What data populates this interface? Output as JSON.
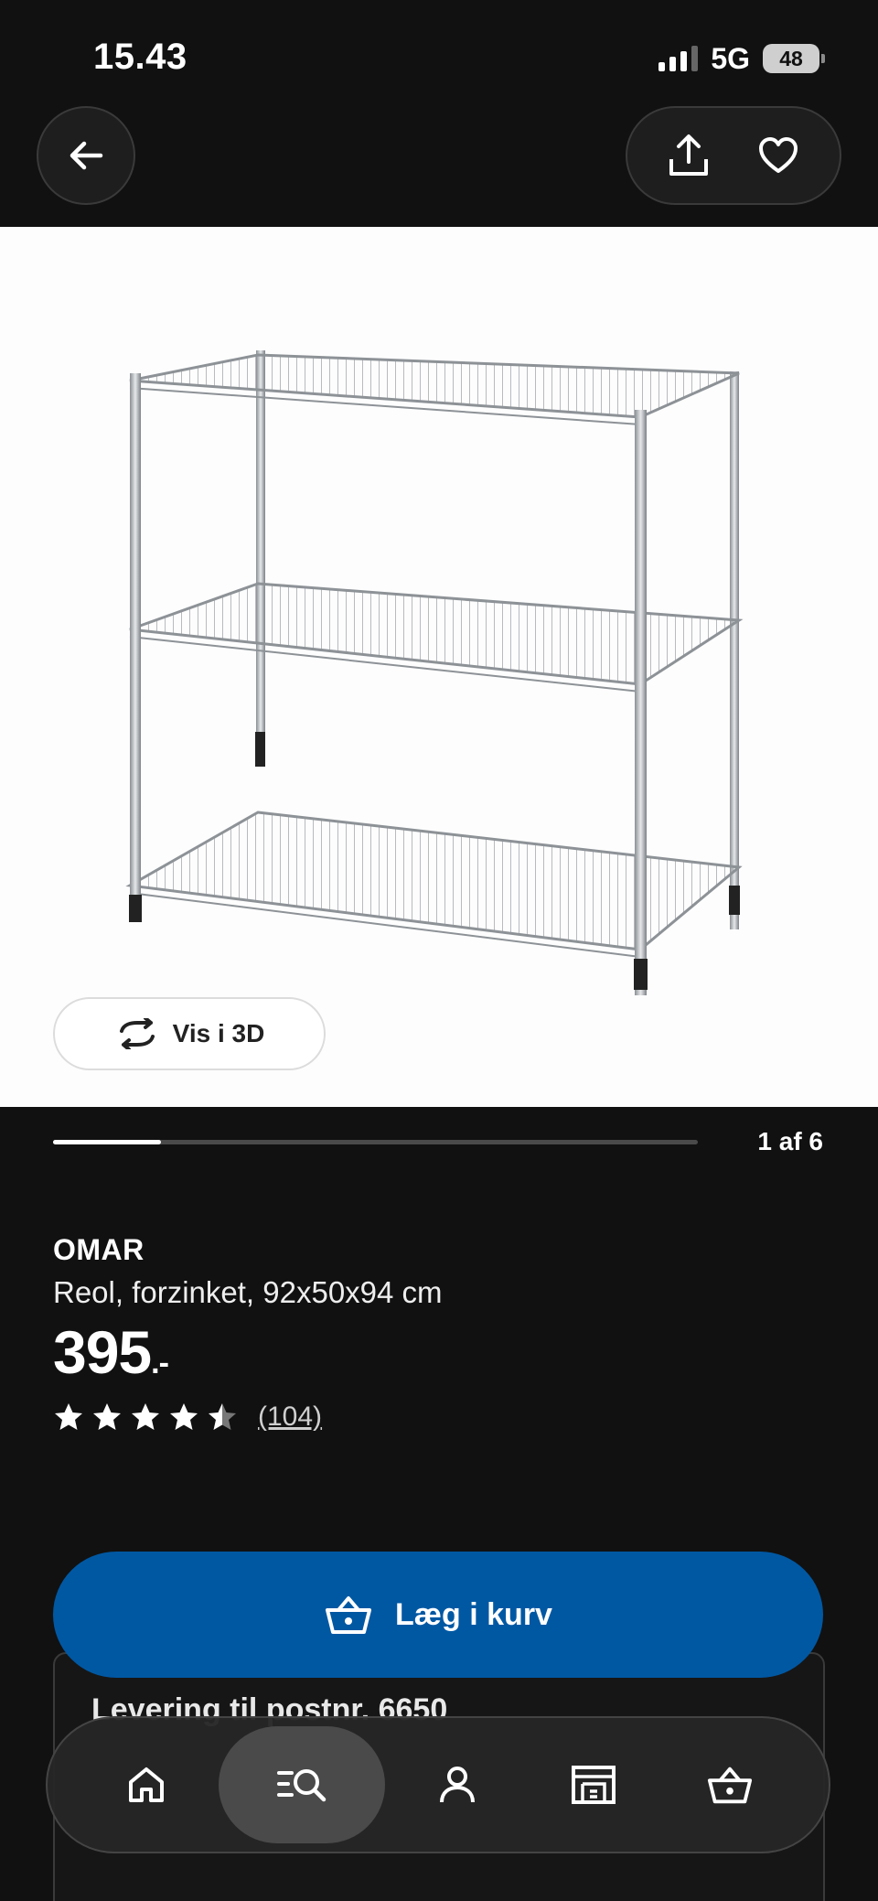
{
  "status": {
    "time": "15.43",
    "network": "5G",
    "battery": "48"
  },
  "product": {
    "brand": "OMAR",
    "description": "Reol, forzinket, 92x50x94 cm",
    "price": "395",
    "price_suffix": ".-",
    "review_count": "(104)",
    "rating": 4.5,
    "rating_max": 5
  },
  "gallery": {
    "view3d_label": "Vis i 3D",
    "counter": "1 af 6",
    "current": 1,
    "total": 6
  },
  "delivery": {
    "heading": "Levering til postnr. 6650"
  },
  "cart": {
    "add_label": "Læg i kurv"
  },
  "tabs": [
    {
      "icon": "home-icon",
      "active": false
    },
    {
      "icon": "search-list-icon",
      "active": true
    },
    {
      "icon": "profile-icon",
      "active": false
    },
    {
      "icon": "store-icon",
      "active": false
    },
    {
      "icon": "basket-icon",
      "active": false
    }
  ],
  "colors": {
    "background": "#111111",
    "accent_blue": "#0058a3",
    "image_bg": "#fdfdfd"
  }
}
